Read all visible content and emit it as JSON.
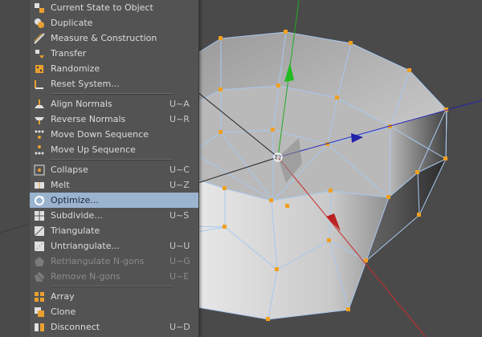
{
  "menu": {
    "items": [
      {
        "label": "Current State to Object",
        "shortcut": "",
        "icon": "current-state-icon",
        "state": "normal"
      },
      {
        "label": "Duplicate",
        "shortcut": "",
        "icon": "duplicate-icon",
        "state": "normal"
      },
      {
        "label": "Measure & Construction",
        "shortcut": "",
        "icon": "measure-icon",
        "state": "normal"
      },
      {
        "label": "Transfer",
        "shortcut": "",
        "icon": "transfer-icon",
        "state": "normal"
      },
      {
        "label": "Randomize",
        "shortcut": "",
        "icon": "randomize-icon",
        "state": "normal"
      },
      {
        "label": "Reset System...",
        "shortcut": "",
        "icon": "reset-system-icon",
        "state": "normal"
      },
      {
        "label": "Align Normals",
        "shortcut": "U~A",
        "icon": "align-normals-icon",
        "state": "normal"
      },
      {
        "label": "Reverse Normals",
        "shortcut": "U~R",
        "icon": "reverse-normals-icon",
        "state": "normal"
      },
      {
        "label": "Move Down Sequence",
        "shortcut": "",
        "icon": "move-down-sequence-icon",
        "state": "normal"
      },
      {
        "label": "Move Up Sequence",
        "shortcut": "",
        "icon": "move-up-sequence-icon",
        "state": "normal"
      },
      {
        "label": "Collapse",
        "shortcut": "U~C",
        "icon": "collapse-icon",
        "state": "normal"
      },
      {
        "label": "Melt",
        "shortcut": "U~Z",
        "icon": "melt-icon",
        "state": "normal"
      },
      {
        "label": "Optimize...",
        "shortcut": "",
        "icon": "optimize-icon",
        "state": "highlighted"
      },
      {
        "label": "Subdivide...",
        "shortcut": "U~S",
        "icon": "subdivide-icon",
        "state": "normal"
      },
      {
        "label": "Triangulate",
        "shortcut": "",
        "icon": "triangulate-icon",
        "state": "normal"
      },
      {
        "label": "Untriangulate...",
        "shortcut": "U~U",
        "icon": "untriangulate-icon",
        "state": "normal"
      },
      {
        "label": "Retriangulate N-gons",
        "shortcut": "U~G",
        "icon": "retriangulate-icon",
        "state": "disabled"
      },
      {
        "label": "Remove N-gons",
        "shortcut": "U~E",
        "icon": "remove-ngons-icon",
        "state": "disabled"
      },
      {
        "label": "Array",
        "shortcut": "",
        "icon": "array-icon",
        "state": "normal"
      },
      {
        "label": "Clone",
        "shortcut": "",
        "icon": "clone-icon",
        "state": "normal"
      },
      {
        "label": "Disconnect",
        "shortcut": "U~D",
        "icon": "disconnect-icon",
        "state": "normal"
      }
    ]
  },
  "colors": {
    "viewport_bg": "#4a4a4a",
    "menu_bg": "#535353",
    "highlight": "#9ab3cf",
    "wire": "#a8c8ee",
    "point": "#f0a020",
    "axis_x": "#cc2a2a",
    "axis_y": "#22aa22",
    "axis_z": "#2a2ab8"
  }
}
